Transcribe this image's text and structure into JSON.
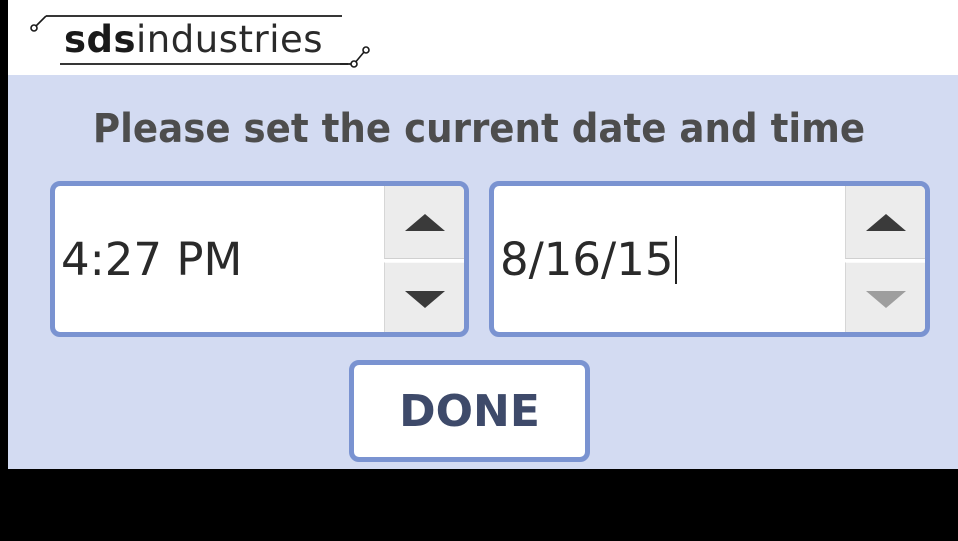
{
  "brand": {
    "logo_bold": "sds",
    "logo_light": "industries"
  },
  "prompt": "Please set the current date and time",
  "time_picker": {
    "value": "4:27 PM",
    "up_icon": "triangle-up",
    "down_icon": "triangle-down"
  },
  "date_picker": {
    "value": "8/16/15",
    "up_icon": "triangle-up",
    "down_icon": "triangle-down",
    "down_disabled": true
  },
  "done_label": "DONE",
  "colors": {
    "panel_background": "#d3dbf2",
    "border_accent": "#7a93d1",
    "prompt_text": "#4d4d4d",
    "done_text": "#3e4a6a"
  }
}
